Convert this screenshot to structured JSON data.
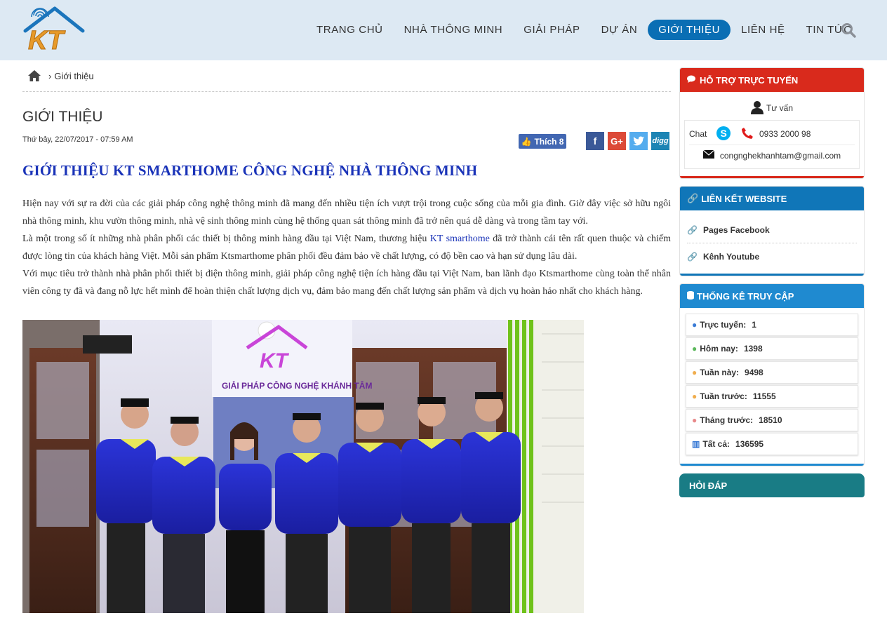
{
  "header": {
    "logo_text": "KT",
    "nav": [
      "TRANG CHỦ",
      "NHÀ THÔNG MINH",
      "GIẢI PHÁP",
      "DỰ ÁN",
      "GIỚI THIỆU",
      "LIÊN HỆ",
      "TIN TỨC"
    ],
    "active_nav": "GIỚI THIỆU"
  },
  "breadcrumb": {
    "separator": "›",
    "current": "Giới thiệu"
  },
  "page_title": "GIỚI THIỆU",
  "article": {
    "date": "Thứ bảy, 22/07/2017 - 07:59 AM",
    "like_label": "Thích 8",
    "title": "GIỚI THIỆU KT SMARTHOME CÔNG NGHỆ NHÀ THÔNG MINH",
    "p1": "Hiện nay với sự ra đời của các giải pháp công nghệ thông minh đã mang đến nhiều tiện ích vượt trội trong cuộc sống của mỗi gia đình. Giờ đây việc sở hữu ngôi nhà thông minh, khu vườn thông minh, nhà vệ sinh thông minh cùng hệ thống quan sát thông minh đã trở nên quá dễ dàng và trong tầm tay với.",
    "p2_before": "Là một trong số ít những nhà phân phối các thiết bị thông minh hàng đầu tại Việt Nam, thương hiệu ",
    "p2_link": "KT smarthome",
    "p2_after": " đã  trở thành cái tên rất quen thuộc và chiếm được lòng tin của khách hàng Việt. Mỗi sản phẩm Ktsmarthome phân phối đều đảm bảo về chất lượng, có độ bền cao và hạn sử dụng lâu dài.",
    "p3": "Với mục tiêu trở thành nhà phân phối thiết bị điện thông minh, giải pháp công nghệ tiện ích hàng đầu tại Việt Nam, ban lãnh đạo Ktsmarthome cùng toàn thể nhân viên công ty đã và đang nỗ lực hết mình để hoàn thiện chất lượng dịch vụ, đảm bảo mang đến chất lượng sản phẩm và dịch vụ hoàn hảo nhất cho khách hàng.",
    "photo_sign": "GIẢI PHÁP CÔNG NGHỆ KHÁNH TÂM",
    "photo_logo": "KT"
  },
  "sidebar": {
    "support": {
      "title": "HỖ TRỢ TRỰC TUYẾN",
      "consultant": "Tư vấn",
      "chat_alt": "Chat",
      "phone": "0933 2000 98",
      "email": "congnghekhanhtam@gmail.com"
    },
    "links": {
      "title": "LIÊN KẾT WEBSITE",
      "items": [
        "Pages Facebook",
        "Kênh Youtube"
      ]
    },
    "stats": {
      "title": "THỐNG KÊ TRUY CẬP",
      "rows": [
        {
          "label": "Trực tuyến:",
          "value": "1"
        },
        {
          "label": "Hôm nay:",
          "value": "1398"
        },
        {
          "label": "Tuần này:",
          "value": "9498"
        },
        {
          "label": "Tuần trước:",
          "value": "11555"
        },
        {
          "label": "Tháng trước:",
          "value": "18510"
        },
        {
          "label": "Tất cả:",
          "value": "136595"
        }
      ]
    },
    "faq": {
      "title": "HỎI ĐÁP"
    }
  },
  "colors": {
    "accent": "#0a6eb4",
    "header_bg": "#dde9f3",
    "title_blue": "#1a33b8",
    "support_red": "#d92a1c"
  },
  "icons": [
    "fingerprint-logo",
    "search-icon",
    "home-icon",
    "facebook-icon",
    "google-plus-icon",
    "twitter-icon",
    "digg-icon",
    "user-icon",
    "skype-icon",
    "phone-icon",
    "envelope-icon",
    "link-icon",
    "chart-icon"
  ]
}
